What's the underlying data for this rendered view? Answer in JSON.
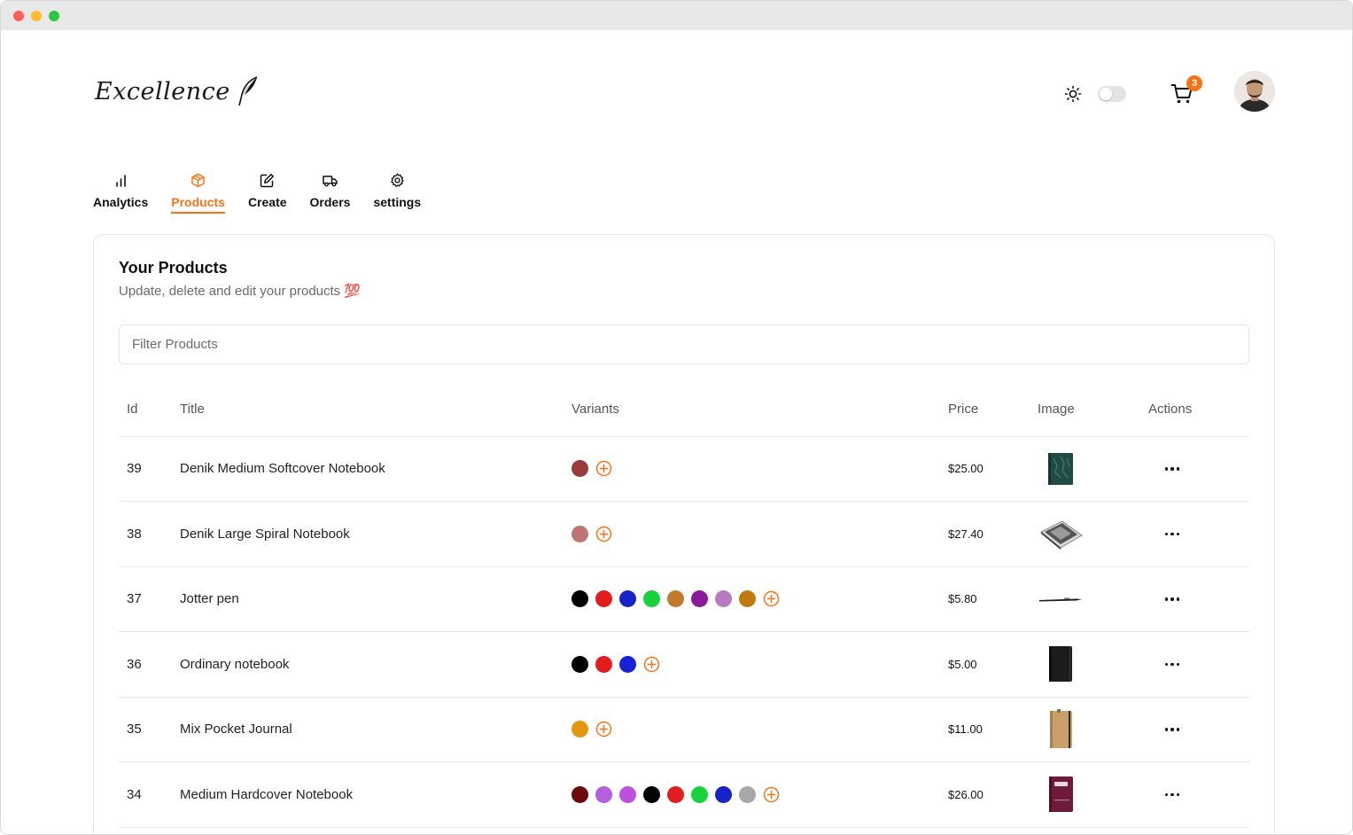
{
  "brand": {
    "logo_text": "Excellence"
  },
  "header": {
    "theme_icon": "sun-icon",
    "toggle_on": false,
    "cart_icon": "cart-icon",
    "cart_count": "3",
    "avatar": "user-avatar"
  },
  "tabs": [
    {
      "label": "Analytics",
      "icon": "bar-chart-icon",
      "active": false
    },
    {
      "label": "Products",
      "icon": "package-icon",
      "active": true
    },
    {
      "label": "Create",
      "icon": "edit-icon",
      "active": false
    },
    {
      "label": "Orders",
      "icon": "truck-icon",
      "active": false
    },
    {
      "label": "settings",
      "icon": "gear-icon",
      "active": false
    }
  ],
  "main": {
    "title": "Your Products",
    "subtitle": "Update, delete and edit your products 💯",
    "filter_placeholder": "Filter Products"
  },
  "table": {
    "columns": [
      "Id",
      "Title",
      "Variants",
      "Price",
      "Image",
      "Actions"
    ],
    "rows": [
      {
        "id": "39",
        "title": "Denik Medium Softcover Notebook",
        "variants": [
          "#9b3b3b"
        ],
        "price": "$25.00",
        "image": "green-notebook-thumbnail"
      },
      {
        "id": "38",
        "title": "Denik Large Spiral Notebook",
        "variants": [
          "#c07575"
        ],
        "price": "$27.40",
        "image": "spiral-notebook-thumbnail"
      },
      {
        "id": "37",
        "title": "Jotter pen",
        "variants": [
          "#000000",
          "#e11d1d",
          "#1722c9",
          "#19d13f",
          "#c07a2a",
          "#8a1a9b",
          "#b87ac0",
          "#c07a12"
        ],
        "price": "$5.80",
        "image": "pen-thumbnail"
      },
      {
        "id": "36",
        "title": "Ordinary notebook",
        "variants": [
          "#000000",
          "#e11d1d",
          "#1722d8"
        ],
        "price": "$5.00",
        "image": "black-notebook-thumbnail"
      },
      {
        "id": "35",
        "title": "Mix Pocket Journal",
        "variants": [
          "#e4960f"
        ],
        "price": "$11.00",
        "image": "kraft-journal-thumbnail"
      },
      {
        "id": "34",
        "title": "Medium Hardcover Notebook",
        "variants": [
          "#6b0b0b",
          "#b45fdc",
          "#c04fe0",
          "#000000",
          "#e11d1d",
          "#19d13f",
          "#1722c9",
          "#a8a8a8"
        ],
        "price": "$26.00",
        "image": "burgundy-notebook-thumbnail"
      }
    ]
  },
  "colors": {
    "accent": "#f97316",
    "border": "#e5e5e5",
    "muted_text": "#6b6b6b"
  }
}
